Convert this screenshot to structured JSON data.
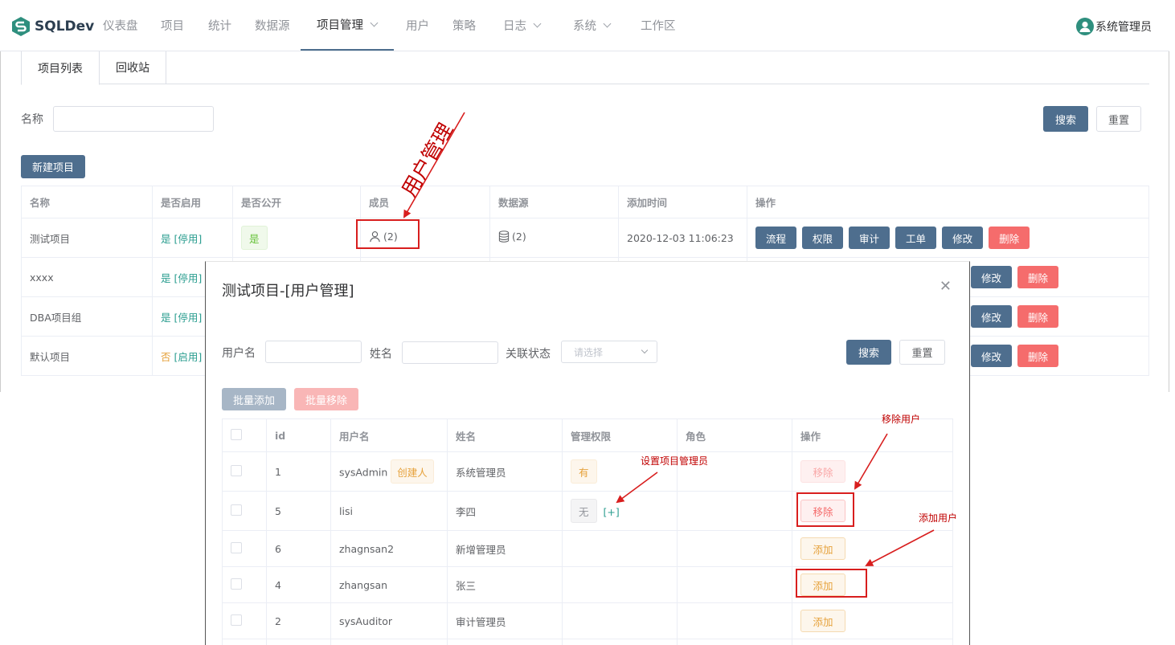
{
  "nav": {
    "brand": "SQLDev",
    "items": [
      {
        "label": "仪表盘"
      },
      {
        "label": "项目"
      },
      {
        "label": "统计"
      },
      {
        "label": "数据源"
      },
      {
        "label": "项目管理"
      },
      {
        "label": "用户"
      },
      {
        "label": "策略"
      },
      {
        "label": "日志"
      },
      {
        "label": "系统"
      },
      {
        "label": "工作区"
      }
    ],
    "user": "系统管理员"
  },
  "tabs": [
    "项目列表",
    "回收站"
  ],
  "filter": {
    "name_label": "名称",
    "search": "搜索",
    "reset": "重置"
  },
  "new_project": "新建项目",
  "projects": {
    "headers": [
      "名称",
      "是否启用",
      "是否公开",
      "成员",
      "数据源",
      "添加时间",
      "操作"
    ],
    "ops": [
      "流程",
      "权限",
      "审计",
      "工单",
      "修改",
      "删除"
    ],
    "rows": [
      {
        "name": "测试项目",
        "enabled": "是",
        "toggle": "[停用]",
        "public": "是",
        "members": "(2)",
        "datasource": "(2)",
        "time": "2020-12-03 11:06:23"
      },
      {
        "name": "xxxx",
        "enabled": "是",
        "toggle": "[停用]"
      },
      {
        "name": "DBA项目组",
        "enabled": "是",
        "toggle": "[停用]"
      },
      {
        "name": "默认项目",
        "enabled": "否",
        "toggle": "[启用]"
      }
    ]
  },
  "dialog": {
    "title": "测试项目-[用户管理]",
    "filter": {
      "username": "用户名",
      "realname": "姓名",
      "status": "关联状态",
      "status_placeholder": "请选择",
      "search": "搜索",
      "reset": "重置"
    },
    "batch_add": "批量添加",
    "batch_remove": "批量移除",
    "headers": [
      "id",
      "用户名",
      "姓名",
      "管理权限",
      "角色",
      "操作"
    ],
    "creator_tag": "创建人",
    "set_admin_link": "[+]",
    "rows": [
      {
        "id": "1",
        "username": "sysAdmin",
        "realname": "系统管理员",
        "admin": "有",
        "action": "移除"
      },
      {
        "id": "5",
        "username": "lisi",
        "realname": "李四",
        "admin": "无",
        "action": "移除"
      },
      {
        "id": "6",
        "username": "zhagnsan2",
        "realname": "新增管理员",
        "admin": "",
        "action": "添加"
      },
      {
        "id": "4",
        "username": "zhangsan",
        "realname": "张三",
        "admin": "",
        "action": "添加"
      },
      {
        "id": "2",
        "username": "sysAuditor",
        "realname": "审计管理员",
        "admin": "",
        "action": "添加"
      }
    ]
  },
  "annotations": {
    "user_mgmt": "用户管理",
    "remove_user": "移除用户",
    "set_admin": "设置项目管理员",
    "add_user": "添加用户"
  },
  "colors": {
    "primary": "#4e6e8e",
    "danger": "#f56c6c",
    "warning": "#e6a23c",
    "success": "#67c23a",
    "annotation": "#d81e1e"
  }
}
